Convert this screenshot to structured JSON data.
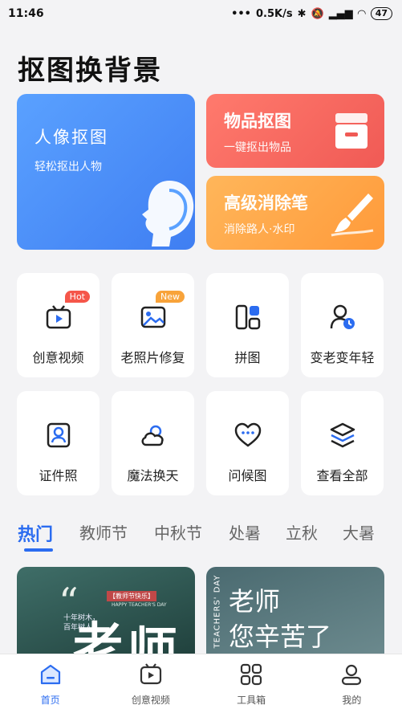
{
  "status_bar": {
    "time": "11:46",
    "net_speed": "0.5K/s",
    "battery": "47"
  },
  "app_title": "抠图换背景",
  "hero": {
    "portrait": {
      "title": "人像抠图",
      "subtitle": "轻松抠出人物"
    },
    "object": {
      "title": "物品抠图",
      "subtitle": "一键抠出物品"
    },
    "eraser": {
      "title": "高级消除笔",
      "subtitle": "消除路人·水印"
    }
  },
  "tools": [
    {
      "label": "创意视频",
      "badge": "Hot",
      "icon": "video-icon"
    },
    {
      "label": "老照片修复",
      "badge": "New",
      "icon": "photo-icon"
    },
    {
      "label": "拼图",
      "icon": "collage-icon"
    },
    {
      "label": "变老变年轻",
      "icon": "age-icon"
    },
    {
      "label": "证件照",
      "icon": "id-photo-icon"
    },
    {
      "label": "魔法换天",
      "icon": "sky-icon"
    },
    {
      "label": "问候图",
      "icon": "greeting-icon"
    },
    {
      "label": "查看全部",
      "icon": "layers-icon"
    }
  ],
  "category_tabs": [
    "热门",
    "教师节",
    "中秋节",
    "处暑",
    "立秋",
    "大暑"
  ],
  "template_cards": [
    {
      "lines": [
        "老",
        "师"
      ],
      "caption": "HAPPY TEACHER'S DAY",
      "tag": "【教师节快乐】",
      "verse": "十年树木，百年树人"
    },
    {
      "lines": [
        "老师",
        "您辛苦了"
      ],
      "caption": "TEACHERS' DAY"
    }
  ],
  "bottom_nav": [
    {
      "label": "首页",
      "active": true
    },
    {
      "label": "创意视频"
    },
    {
      "label": "工具箱"
    },
    {
      "label": "我的"
    }
  ],
  "colors": {
    "accent": "#2b6cf0",
    "hot": "#f5564a",
    "new": "#f8a33a"
  }
}
